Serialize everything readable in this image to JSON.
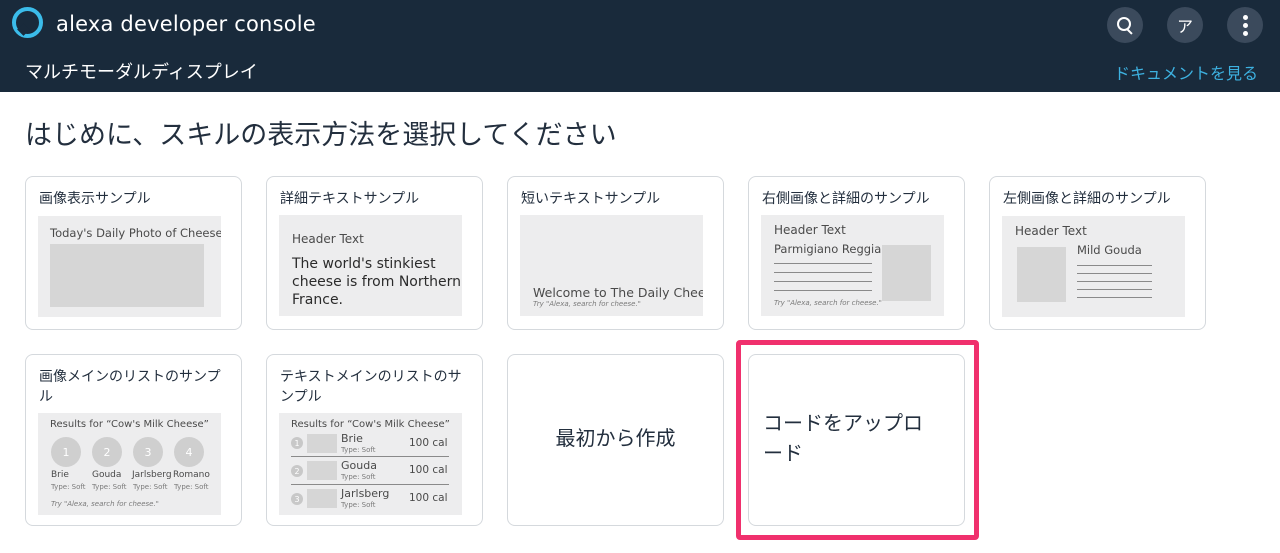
{
  "app": {
    "brand": "alexa developer console",
    "page_name": "マルチモーダルディスプレイ",
    "docs_link": "ドキュメントを見る"
  },
  "header": {
    "avatar_initial": "ア",
    "icons": [
      "search-icon",
      "avatar",
      "more-vertical-icon"
    ]
  },
  "main": {
    "heading": "はじめに、スキルの表示方法を選択してください"
  },
  "cards": {
    "image_display": {
      "title": "画像表示サンプル",
      "preview_title": "Today's Daily Photo of Cheese"
    },
    "detail_text": {
      "title": "詳細テキストサンプル",
      "header": "Header Text",
      "body": [
        "The world's stinkiest",
        "cheese is from Northern",
        "France."
      ]
    },
    "short_text": {
      "title": "短いテキストサンプル",
      "body": "Welcome to The Daily Cheese",
      "hint": "Try \"Alexa, search for cheese.\""
    },
    "right_image_detail": {
      "title": "右側画像と詳細のサンプル",
      "header": "Header Text",
      "subtitle": "Parmigiano Reggiano",
      "hint": "Try \"Alexa, search for cheese.\""
    },
    "left_image_detail": {
      "title": "左側画像と詳細のサンプル",
      "header": "Header Text",
      "subtitle": "Mild Gouda"
    },
    "image_list": {
      "title": "画像メインのリストのサンプル",
      "results": "Results for “Cow's Milk Cheese”",
      "items": [
        {
          "num": "1",
          "name": "Brie",
          "type": "Type: Soft"
        },
        {
          "num": "2",
          "name": "Gouda",
          "type": "Type: Soft"
        },
        {
          "num": "3",
          "name": "Jarlsberg",
          "type": "Type: Soft"
        },
        {
          "num": "4",
          "name": "Romano",
          "type": "Type: Soft"
        }
      ],
      "hint": "Try \"Alexa, search for cheese.\""
    },
    "text_list": {
      "title": "テキストメインのリストのサンプル",
      "results": "Results for “Cow's Milk Cheese”",
      "items": [
        {
          "num": "1",
          "name": "Brie",
          "type": "Type: Soft",
          "cal": "100 cal"
        },
        {
          "num": "2",
          "name": "Gouda",
          "type": "Type: Soft",
          "cal": "100 cal"
        },
        {
          "num": "3",
          "name": "Jarlsberg",
          "type": "Type: Soft",
          "cal": "100 cal"
        }
      ]
    },
    "from_scratch": {
      "title": "最初から作成"
    },
    "upload_code": {
      "title_line1": "コードをアップロ",
      "title_line2": "ード"
    }
  },
  "colors": {
    "header_bg": "#192a3b",
    "link": "#3db1e0",
    "highlight": "#f0306d",
    "logo": "#3bbcea"
  }
}
